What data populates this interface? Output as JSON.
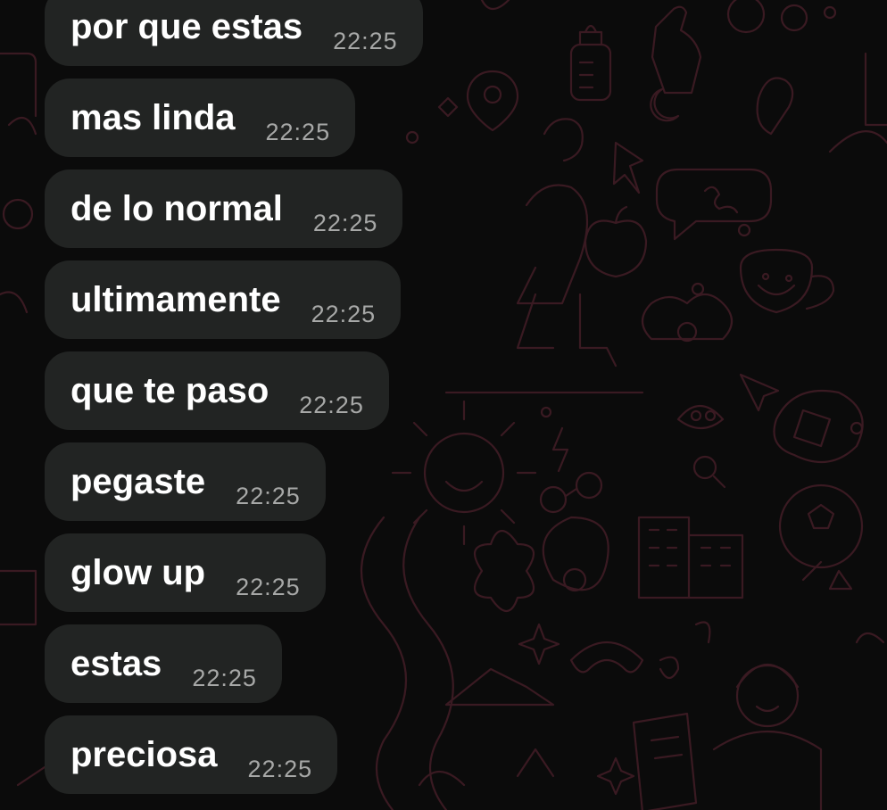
{
  "theme": {
    "background": "#0b0b0b",
    "bubble": "#222423",
    "text": "#ffffff",
    "timestamp": "#a7a8a7",
    "doodle": "#3a1a22"
  },
  "messages": [
    {
      "text": "por que estas",
      "time": "22:25"
    },
    {
      "text": "mas linda",
      "time": "22:25"
    },
    {
      "text": "de lo normal",
      "time": "22:25"
    },
    {
      "text": "ultimamente",
      "time": "22:25"
    },
    {
      "text": "que te paso",
      "time": "22:25"
    },
    {
      "text": "pegaste",
      "time": "22:25"
    },
    {
      "text": "glow up",
      "time": "22:25"
    },
    {
      "text": "estas",
      "time": "22:25"
    },
    {
      "text": "preciosa",
      "time": "22:25"
    }
  ]
}
